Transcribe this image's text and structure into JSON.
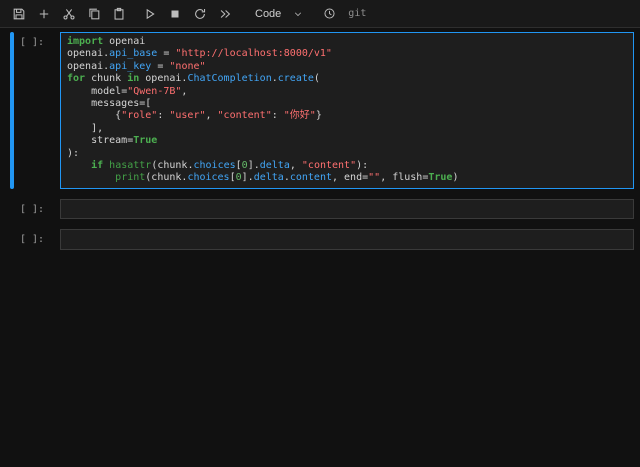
{
  "colors": {
    "background": "#111111",
    "toolbar_bg": "#191919",
    "toolbar_border": "#2e2e2e",
    "editor_bg": "#1e1e1e",
    "editor_border": "#3a3a3a",
    "accent": "#2196f3",
    "text": "#d4d4d4",
    "keyword": "#4caf50",
    "builtin": "#43a047",
    "property": "#42a5f5",
    "string": "#ff7070",
    "number": "#66bb6a",
    "operator": "#d4d4d4",
    "prompt": "#9e9e9e",
    "icon": "#bdbdbd",
    "label": "#cfcfcf",
    "git": "#8f8f8f"
  },
  "toolbar": {
    "cell_type": "Code",
    "git_label": "git",
    "icons": [
      "save-icon",
      "add-cell-icon",
      "cut-icon",
      "copy-icon",
      "paste-icon",
      "run-icon",
      "stop-icon",
      "restart-kernel-icon",
      "restart-run-all-icon",
      "chevron-down-icon",
      "clock-icon"
    ]
  },
  "cells": [
    {
      "prompt": "[ ]:",
      "active": true,
      "lines": [
        [
          [
            "kw",
            "import"
          ],
          [
            "pl",
            " openai"
          ]
        ],
        [
          [
            "pl",
            "openai."
          ],
          [
            "prop",
            "api_base"
          ],
          [
            "pl",
            " "
          ],
          [
            "op",
            "="
          ],
          [
            "pl",
            " "
          ],
          [
            "str",
            "\"http://localhost:8000/v1\""
          ]
        ],
        [
          [
            "pl",
            "openai."
          ],
          [
            "prop",
            "api_key"
          ],
          [
            "pl",
            " "
          ],
          [
            "op",
            "="
          ],
          [
            "pl",
            " "
          ],
          [
            "str",
            "\"none\""
          ]
        ],
        [
          [
            "kw",
            "for"
          ],
          [
            "pl",
            " chunk "
          ],
          [
            "kw",
            "in"
          ],
          [
            "pl",
            " openai."
          ],
          [
            "prop",
            "ChatCompletion"
          ],
          [
            "pl",
            "."
          ],
          [
            "prop",
            "create"
          ],
          [
            "pl",
            "("
          ]
        ],
        [
          [
            "pl",
            "    model"
          ],
          [
            "op",
            "="
          ],
          [
            "str",
            "\"Qwen-7B\""
          ],
          [
            "pl",
            ","
          ]
        ],
        [
          [
            "pl",
            "    messages"
          ],
          [
            "op",
            "="
          ],
          [
            "pl",
            "["
          ]
        ],
        [
          [
            "pl",
            "        {"
          ],
          [
            "str",
            "\"role\""
          ],
          [
            "pl",
            ": "
          ],
          [
            "str",
            "\"user\""
          ],
          [
            "pl",
            ", "
          ],
          [
            "str",
            "\"content\""
          ],
          [
            "pl",
            ": "
          ],
          [
            "str",
            "\"你好\""
          ],
          [
            "pl",
            "}"
          ]
        ],
        [
          [
            "pl",
            "    ],"
          ]
        ],
        [
          [
            "pl",
            "    stream"
          ],
          [
            "op",
            "="
          ],
          [
            "kw",
            "True"
          ]
        ],
        [
          [
            "pl",
            "):"
          ]
        ],
        [
          [
            "pl",
            "    "
          ],
          [
            "kw",
            "if"
          ],
          [
            "pl",
            " "
          ],
          [
            "bi",
            "hasattr"
          ],
          [
            "pl",
            "(chunk."
          ],
          [
            "prop",
            "choices"
          ],
          [
            "pl",
            "["
          ],
          [
            "num",
            "0"
          ],
          [
            "pl",
            "]."
          ],
          [
            "prop",
            "delta"
          ],
          [
            "pl",
            ", "
          ],
          [
            "str",
            "\"content\""
          ],
          [
            "pl",
            "):"
          ]
        ],
        [
          [
            "pl",
            "        "
          ],
          [
            "bi",
            "print"
          ],
          [
            "pl",
            "(chunk."
          ],
          [
            "prop",
            "choices"
          ],
          [
            "pl",
            "["
          ],
          [
            "num",
            "0"
          ],
          [
            "pl",
            "]."
          ],
          [
            "prop",
            "delta"
          ],
          [
            "pl",
            "."
          ],
          [
            "prop",
            "content"
          ],
          [
            "pl",
            ", end"
          ],
          [
            "op",
            "="
          ],
          [
            "str",
            "\"\""
          ],
          [
            "pl",
            ", flush"
          ],
          [
            "op",
            "="
          ],
          [
            "kw",
            "True"
          ],
          [
            "pl",
            ")"
          ]
        ]
      ]
    },
    {
      "prompt": "[ ]:",
      "active": false,
      "lines": []
    },
    {
      "prompt": "[ ]:",
      "active": false,
      "lines": []
    }
  ]
}
